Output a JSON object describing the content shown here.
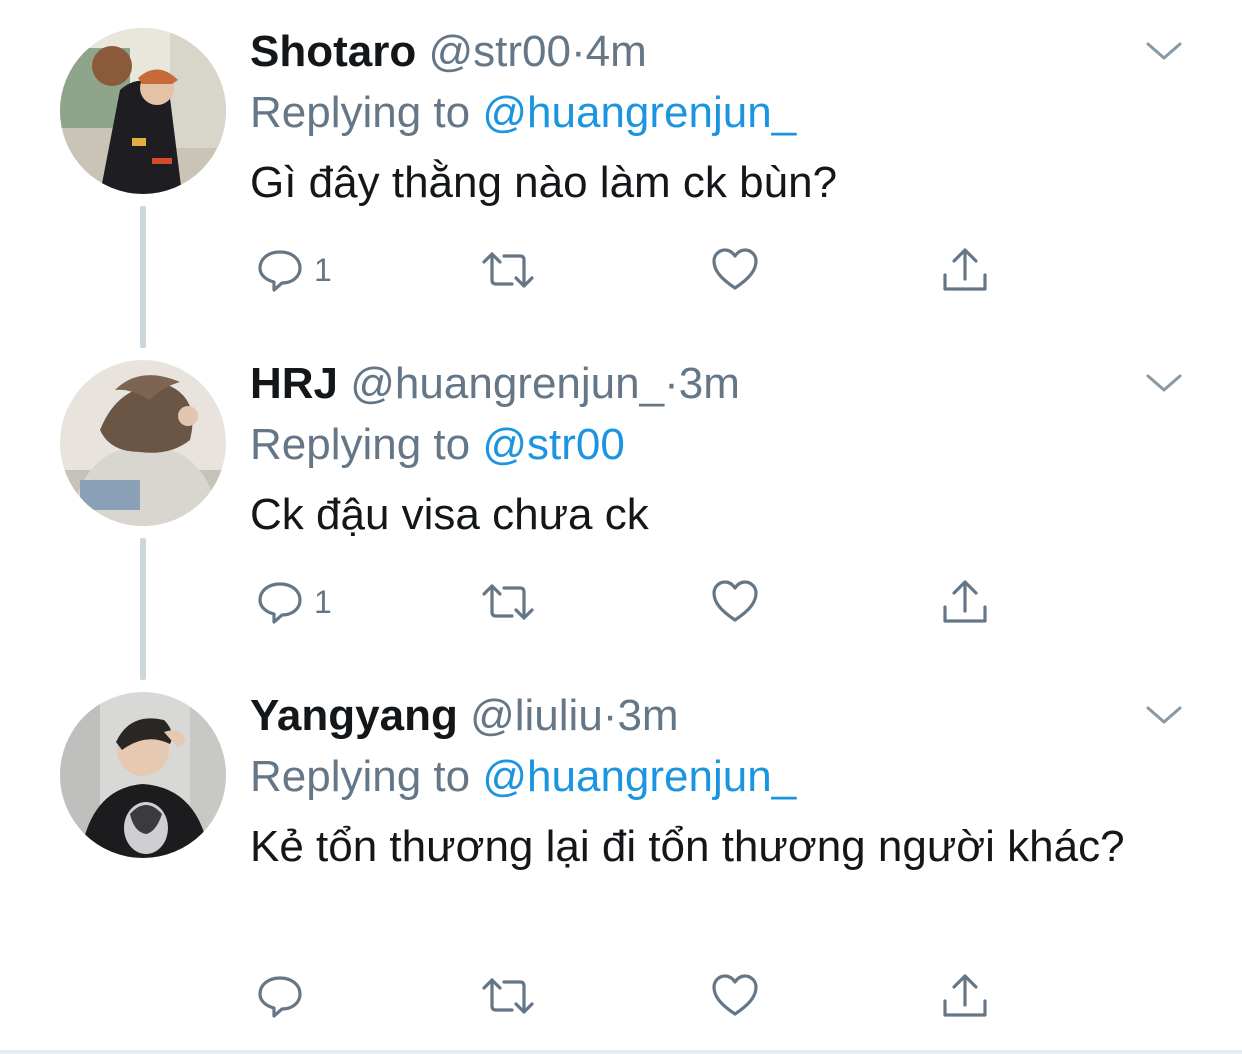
{
  "colors": {
    "text": "#14171a",
    "secondary": "#657786",
    "link": "#1b95e0",
    "thread_line": "#ccd6dd"
  },
  "tweets": [
    {
      "display_name": "Shotaro",
      "handle": "@str00",
      "separator": "·",
      "time": "4m",
      "replying_prefix": "Replying to",
      "replying_to": "@huangrenjun_",
      "text": "Gì đây thằng nào làm ck bùn?",
      "reply_count": "1",
      "icons": [
        "caret-down-icon",
        "reply-icon",
        "retweet-icon",
        "like-icon",
        "share-icon"
      ]
    },
    {
      "display_name": "HRJ",
      "handle": "@huangrenjun_",
      "separator": "·",
      "time": "3m",
      "replying_prefix": "Replying to",
      "replying_to": "@str00",
      "text": "Ck đậu visa chưa ck",
      "reply_count": "1",
      "icons": [
        "caret-down-icon",
        "reply-icon",
        "retweet-icon",
        "like-icon",
        "share-icon"
      ]
    },
    {
      "display_name": "Yangyang",
      "handle": "@liuliu",
      "separator": "·",
      "time": "3m",
      "replying_prefix": "Replying to",
      "replying_to": "@huangrenjun_",
      "text": "Kẻ tổn thương lại đi tổn thương người khác?",
      "reply_count": "",
      "icons": [
        "caret-down-icon",
        "reply-icon",
        "retweet-icon",
        "like-icon",
        "share-icon"
      ]
    }
  ]
}
